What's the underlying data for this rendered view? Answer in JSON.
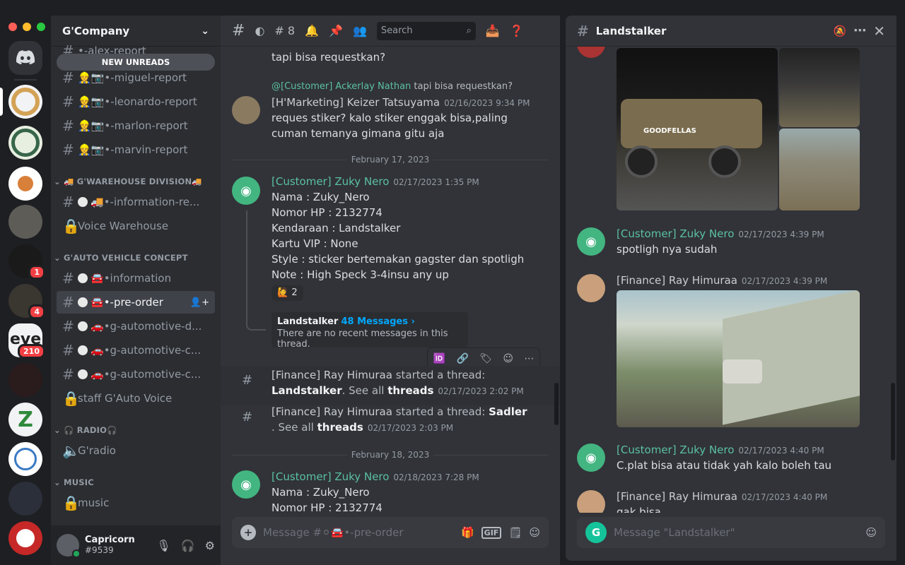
{
  "server": {
    "name": "G'Company"
  },
  "sidebar": {
    "new_unreads": "NEW UNREADS",
    "top_partial": "•‑alex‑report",
    "channels": [
      {
        "label": "•‑miguel‑report"
      },
      {
        "label": "•‑leonardo‑report"
      },
      {
        "label": "•‑marlon‑report"
      },
      {
        "label": "•‑marvin‑report"
      }
    ],
    "cat_warehouse": "G'WAREHOUSE DIVISION",
    "warehouse": [
      {
        "label": "•‑information‑re..."
      },
      {
        "label": "Voice Warehouse"
      }
    ],
    "cat_auto": "G'AUTO VEHICLE CONCEPT",
    "auto": [
      {
        "label": "•information"
      },
      {
        "label": "•‑pre‑order"
      },
      {
        "label": "•g‑automotive‑d..."
      },
      {
        "label": "•g‑automotive‑c..."
      },
      {
        "label": "•g‑automotive‑c..."
      },
      {
        "label": "staff G'Auto Voice"
      }
    ],
    "cat_radio": "RADIO",
    "radio": "G'radio",
    "cat_music": "MUSIC",
    "music": "music"
  },
  "user": {
    "name": "Capricorn",
    "tag": "#9539"
  },
  "guild_badges": [
    "1",
    "4",
    "210"
  ],
  "topbar": {
    "thread_count": "8",
    "search_placeholder": "Search"
  },
  "messages": {
    "m0_text": "tapi bisa requestkan?",
    "reply_ref": "@[Customer] Ackerlay Nathan",
    "reply_text": "tapi bisa requestkan?",
    "m1_author": "[H'Marketing] Keizer Tatsuyama",
    "m1_time": "02/16/2023 9:34 PM",
    "m1_line1": "reques stiker? kalo stiker enggak bisa,paling",
    "m1_line2": "cuman temanya gimana gitu aja",
    "date1": "February 17, 2023",
    "m2_author": "[Customer] Zuky Nero",
    "m2_time": "02/17/2023 1:35 PM",
    "m2_lines": [
      "Nama : Zuky_Nero",
      "Nomor HP : 2132774",
      "Kendaraan : Landstalker",
      "Kartu VIP : None",
      "Style : sticker bertemakan gagster dan spotligh",
      "Note : High Speck 3-4insu any up"
    ],
    "reaction_count": "2",
    "thread_name": "Landstalker",
    "thread_msgs": "48 Messages ›",
    "thread_note": "There are no recent messages in this thread.",
    "s1_author": "[Finance] Ray Himuraa",
    "s1_text": "started a thread:",
    "s1_thread": "Landstalker",
    "s1_see": ". See all",
    "s1_threads": "threads",
    "s1_time": "02/17/2023 2:02 PM",
    "s2_author": "[Finance] Ray Himuraa",
    "s2_text": "started a thread:",
    "s2_thread": "Sadler",
    "s2_see": ". See all",
    "s2_threads": "threads",
    "s2_time": "02/17/2023 2:03 PM",
    "date2": "February 18, 2023",
    "m3_author": "[Customer] Zuky Nero",
    "m3_time": "02/18/2023 7:28 PM",
    "m3_line1": "Nama : Zuky_Nero",
    "m3_line2": "Nomor HP : 2132774",
    "compose_placeholder": "Message #⚪🚘•‑pre‑order"
  },
  "thread_panel": {
    "title": "Landstalker",
    "t1_author": "[Customer] Zuky Nero",
    "t1_time": "02/17/2023 4:39 PM",
    "t1_text": "spotligh nya sudah",
    "t2_author": "[Finance] Ray Himuraa",
    "t2_time": "02/17/2023 4:39 PM",
    "t3_author": "[Customer] Zuky Nero",
    "t3_time": "02/17/2023 4:40 PM",
    "t3_text": "C.plat bisa atau tidak yah kalo boleh tau",
    "t4_author": "[Finance] Ray Himuraa",
    "t4_time": "02/17/2023 4:40 PM",
    "t4_text": "gak bisa",
    "compose_placeholder": "Message \"Landstalker\"",
    "car_label": "GOODFELLAS"
  }
}
